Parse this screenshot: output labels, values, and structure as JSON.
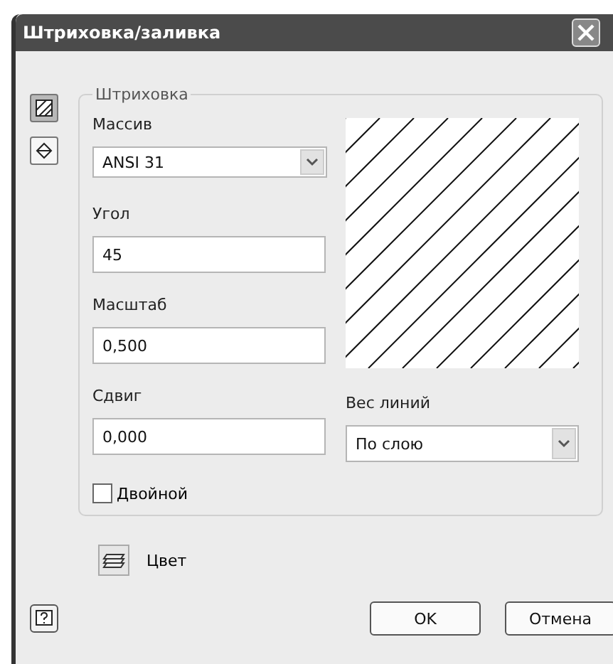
{
  "window": {
    "title": "Штриховка/заливка"
  },
  "side_tools": [
    {
      "kind": "hatch",
      "selected": true
    },
    {
      "kind": "fill",
      "selected": false
    }
  ],
  "group": {
    "title": "Штриховка",
    "pattern": {
      "label": "Массив",
      "value": "ANSI 31"
    },
    "angle": {
      "label": "Угол",
      "value": "45"
    },
    "scale": {
      "label": "Масштаб",
      "value": "0,500"
    },
    "offset": {
      "label": "Сдвиг",
      "value": "0,000"
    },
    "lineweight": {
      "label": "Вес линий",
      "value": "По слою"
    },
    "double": {
      "label": "Двойной",
      "checked": false
    }
  },
  "color": {
    "label": "Цвет"
  },
  "buttons": [
    "OK",
    "Отмена"
  ]
}
